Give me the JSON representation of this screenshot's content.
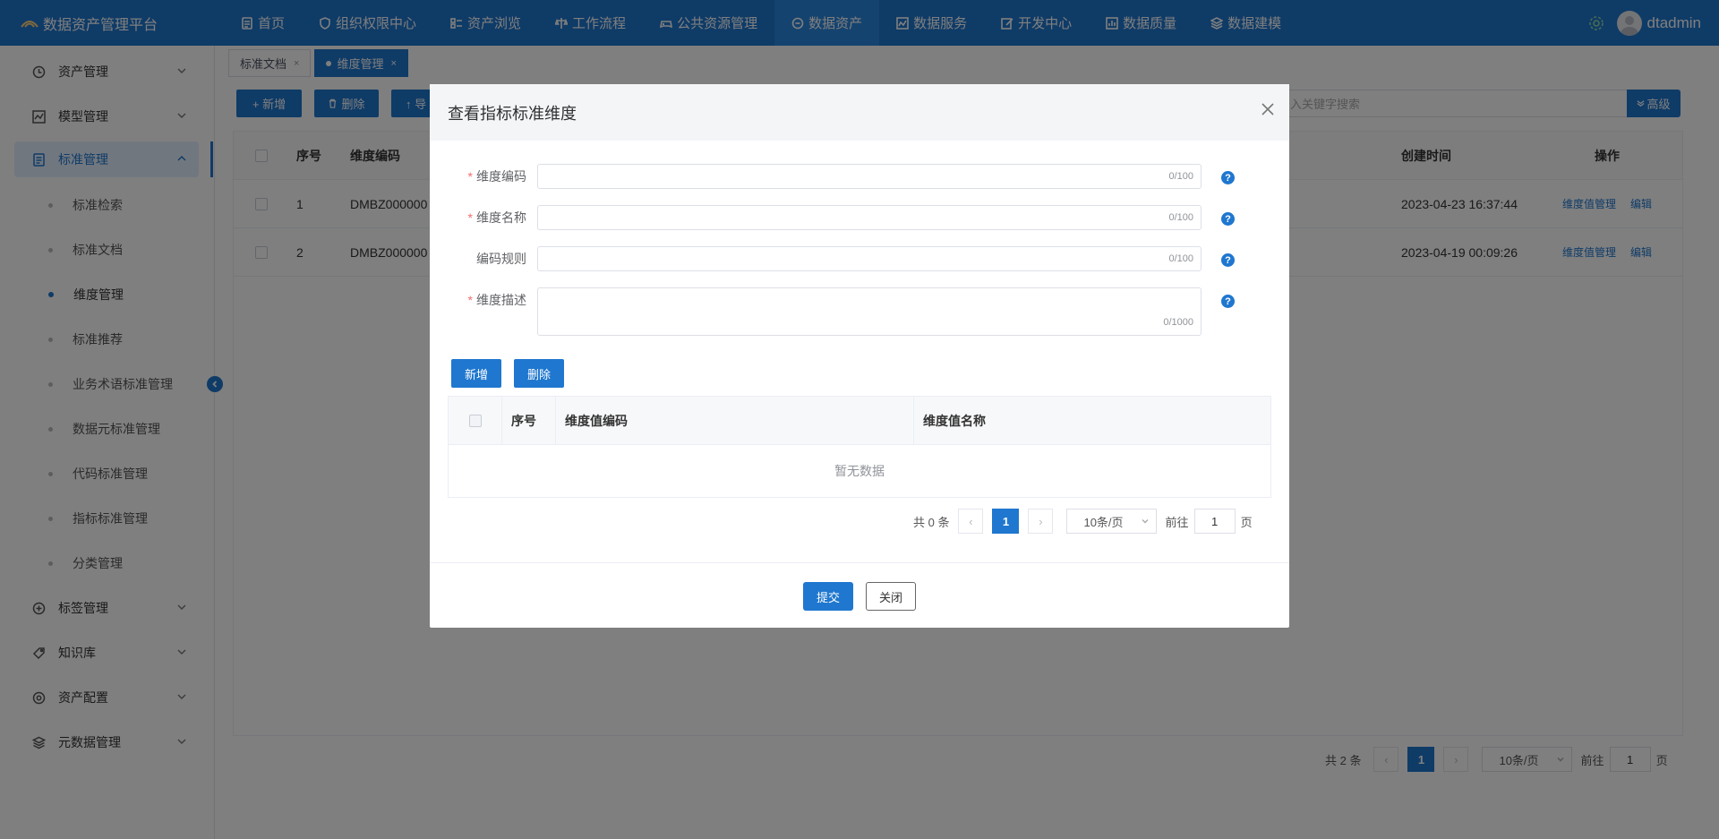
{
  "app": {
    "title": "数据资产管理平台",
    "user": "dtadmin"
  },
  "nav": [
    {
      "label": "首页",
      "icon": "document-icon"
    },
    {
      "label": "组织权限中心",
      "icon": "shield-icon"
    },
    {
      "label": "资产浏览",
      "icon": "list-icon"
    },
    {
      "label": "工作流程",
      "icon": "scale-icon"
    },
    {
      "label": "公共资源管理",
      "icon": "gamepad-icon"
    },
    {
      "label": "数据资产",
      "icon": "database-icon",
      "active": true
    },
    {
      "label": "数据服务",
      "icon": "chart-icon"
    },
    {
      "label": "开发中心",
      "icon": "edit-icon"
    },
    {
      "label": "数据质量",
      "icon": "bar-chart-icon"
    },
    {
      "label": "数据建模",
      "icon": "layers-icon"
    }
  ],
  "sidebar": {
    "items": [
      {
        "label": "资产管理",
        "icon": "clock-icon"
      },
      {
        "label": "模型管理",
        "icon": "line-chart-icon"
      },
      {
        "label": "标准管理",
        "icon": "document-icon",
        "open": true
      },
      {
        "label": "标签管理",
        "icon": "plus-circle-icon"
      },
      {
        "label": "知识库",
        "icon": "tag-icon"
      },
      {
        "label": "资产配置",
        "icon": "settings-icon"
      },
      {
        "label": "元数据管理",
        "icon": "layers-icon"
      }
    ],
    "sub_items": [
      {
        "label": "标准检索"
      },
      {
        "label": "标准文档"
      },
      {
        "label": "维度管理",
        "active": true
      },
      {
        "label": "标准推荐"
      },
      {
        "label": "业务术语标准管理"
      },
      {
        "label": "数据元标准管理"
      },
      {
        "label": "代码标准管理"
      },
      {
        "label": "指标标准管理"
      },
      {
        "label": "分类管理"
      }
    ]
  },
  "tabs": [
    {
      "label": "标准文档",
      "close": "×"
    },
    {
      "label": "维度管理",
      "close": "×",
      "active": true
    }
  ],
  "toolbar": {
    "add": "+ 新增",
    "delete": "删除",
    "import": "↑ 导",
    "search_placeholder": "入关键字搜索",
    "advanced": "高级"
  },
  "main_table": {
    "headers": {
      "seq": "序号",
      "code": "维度编码",
      "created": "创建时间",
      "ops": "操作"
    },
    "rows": [
      {
        "seq": "1",
        "code": "DMBZ000000",
        "created": "2023-04-23 16:37:44",
        "op1": "维度值管理",
        "op2": "编辑"
      },
      {
        "seq": "2",
        "code": "DMBZ000000",
        "created": "2023-04-19 00:09:26",
        "op1": "维度值管理",
        "op2": "编辑"
      }
    ]
  },
  "main_pager": {
    "total": "共 2 条",
    "page": "1",
    "size": "10条/页",
    "goto": "前往",
    "goto_value": "1",
    "unit": "页"
  },
  "modal": {
    "title": "查看指标标准维度",
    "fields": [
      {
        "label": "维度编码",
        "required": "*",
        "count": "0/100"
      },
      {
        "label": "维度名称",
        "required": "*",
        "count": "0/100"
      },
      {
        "label": "编码规则",
        "required": "",
        "count": "0/100"
      },
      {
        "label": "维度描述",
        "required": "*",
        "count": "0/1000"
      }
    ],
    "help": "?",
    "add": "新增",
    "delete": "删除",
    "table_headers": {
      "seq": "序号",
      "value_code": "维度值编码",
      "value_name": "维度值名称"
    },
    "empty": "暂无数据",
    "pager": {
      "total": "共 0 条",
      "page": "1",
      "size": "10条/页",
      "goto": "前往",
      "goto_value": "1",
      "unit": "页"
    },
    "submit": "提交",
    "close": "关闭"
  },
  "colors": {
    "primary": "#1f77cf",
    "required": "#f56c6c"
  }
}
